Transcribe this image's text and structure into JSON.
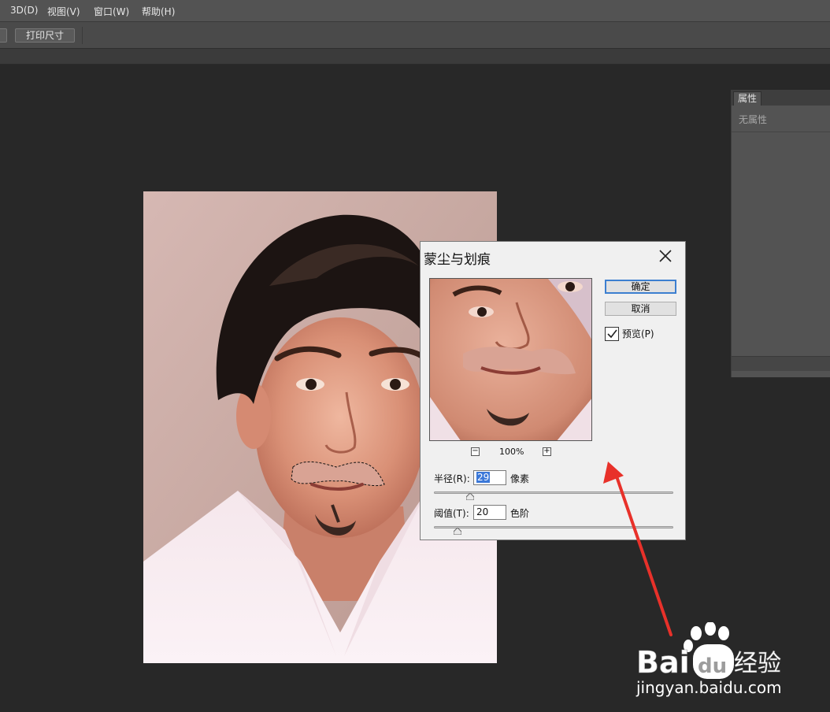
{
  "menu": {
    "items": [
      "3D(D)",
      "视图(V)",
      "窗口(W)",
      "帮助(H)"
    ]
  },
  "options_bar": {
    "print_size_label": "打印尺寸"
  },
  "properties_panel": {
    "tab_label": "属性",
    "empty_text": "无属性"
  },
  "dialog": {
    "title": "蒙尘与划痕",
    "ok_label": "确定",
    "cancel_label": "取消",
    "preview_label": "预览(P)",
    "preview_checked": true,
    "zoom_minus": "−",
    "zoom_plus": "+",
    "zoom_level": "100%",
    "radius": {
      "label": "半径(R):",
      "value": "29",
      "unit": "像素",
      "slider_fraction": 0.15
    },
    "threshold": {
      "label": "阈值(T):",
      "value": "20",
      "unit": "色阶",
      "slider_fraction": 0.1
    }
  },
  "watermark": {
    "text_bai": "Bai",
    "text_du": "du",
    "text_jingyan": "经验",
    "url": "jingyan.baidu.com"
  },
  "colors": {
    "annotation_arrow": "#e8312a",
    "dialog_default_border": "#3c7fd0",
    "selection": "#3b78d8"
  }
}
